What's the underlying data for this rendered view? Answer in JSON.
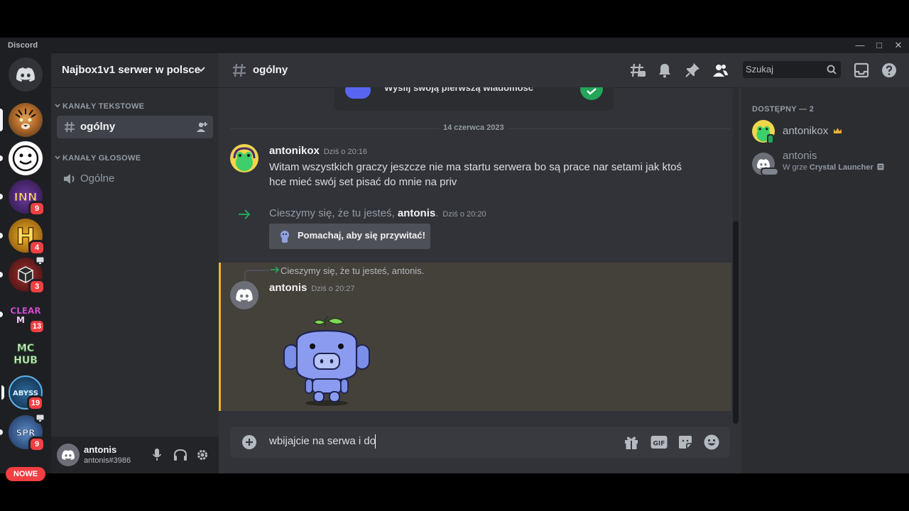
{
  "app": {
    "name": "Discord"
  },
  "colors": {
    "accent": "#5865f2",
    "mention_bg": "#44403a",
    "mention_bar": "#f0b232",
    "online": "#23a55a",
    "badge": "#f23f43"
  },
  "rail": {
    "servers": [
      {
        "name": "tiger-server",
        "badge": ""
      },
      {
        "name": "smiley-server",
        "badge": ""
      },
      {
        "name": "inn-server",
        "badge": "9"
      },
      {
        "name": "h-server",
        "badge": "4"
      },
      {
        "name": "polish-server",
        "badge": "3"
      },
      {
        "name": "clear-server",
        "badge": "13"
      },
      {
        "name": "mchub-server",
        "badge": ""
      },
      {
        "name": "abyss-server",
        "badge": "19"
      },
      {
        "name": "spr-server",
        "badge": "9"
      }
    ],
    "new_label": "NOWE"
  },
  "sidebar": {
    "guild_name": "Najbox1v1 serwer w polsce",
    "text_category": "KANAŁY TEKSTOWE",
    "text_channel": "ogólny",
    "voice_category": "KANAŁY GŁOSOWE",
    "voice_channel": "Ogólne"
  },
  "user": {
    "name": "antonis",
    "tag": "antonis#3986"
  },
  "header": {
    "channel": "ogólny",
    "search_placeholder": "Szukaj"
  },
  "messages": {
    "welcome_card_text": "Wyślij swoją pierwszą wiadomość",
    "date_divider": "14 czerwca 2023",
    "m1": {
      "author": "antonikox",
      "time": "Dziś o 20:16",
      "line1": "Witam wszystkich graczy jeszcze nie ma startu serwera bo są prace nar setami jak ktoś",
      "line2": "hce mieć swój set pisać do mnie na priv"
    },
    "join": {
      "prefix": "Cieszymy się, że tu jesteś,",
      "name": "antonis",
      "suffix": ".",
      "time": "Dziś o 20:20",
      "wave_button": "Pomachaj, aby się przywitać!"
    },
    "reply": {
      "quote": "Cieszymy się, że tu jesteś, antonis.",
      "author": "antonis",
      "time": "Dziś o 20:27"
    }
  },
  "composer": {
    "value": "wbijajcie na serwa i do"
  },
  "members": {
    "header": "DOSTĘPNY — 2",
    "list": [
      {
        "name": "antonikox",
        "activity_prefix": "",
        "activity": ""
      },
      {
        "name": "antonis",
        "activity_prefix": "W grze",
        "activity": "Crystal Launcher"
      }
    ]
  }
}
